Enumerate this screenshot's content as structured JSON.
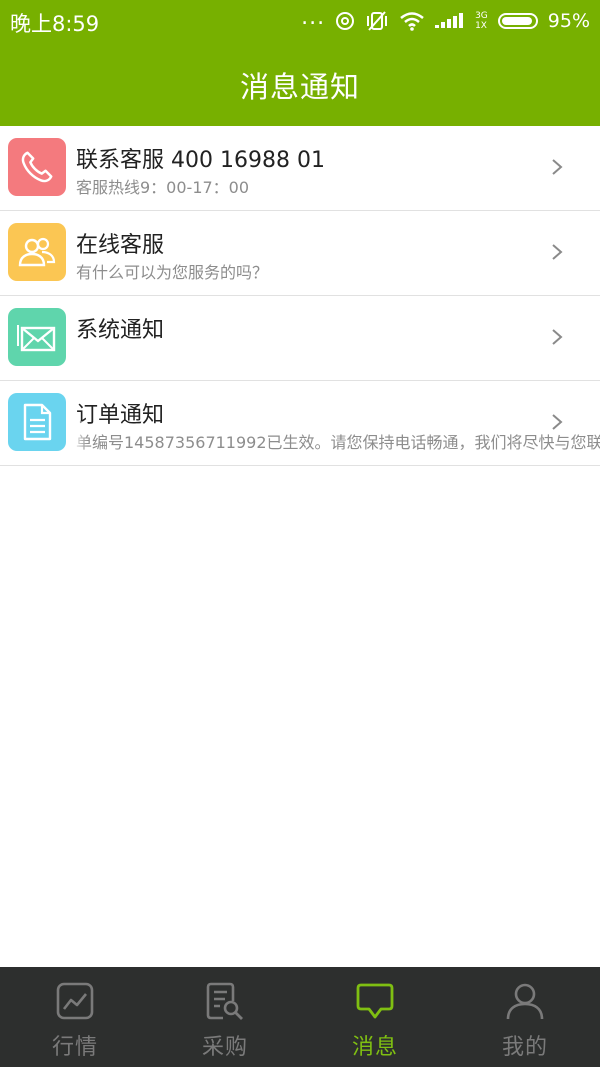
{
  "status_bar": {
    "time": "晚上8:59",
    "dots": "...",
    "network_top": "3G",
    "network_bottom": "1X",
    "battery": "95%"
  },
  "header": {
    "title": "消息通知"
  },
  "items": [
    {
      "title": "联系客服 400 16988 01",
      "subtitle": "客服热线9：00-17：00",
      "icon": "phone-icon",
      "icon_color": "#f47a7e"
    },
    {
      "title": "在线客服",
      "subtitle": "有什么可以为您服务的吗？",
      "icon": "people-icon",
      "icon_color": "#fbc653"
    },
    {
      "title": "系统通知",
      "subtitle": "",
      "icon": "envelope-icon",
      "icon_color": "#5fd5ac"
    },
    {
      "title": "订单通知",
      "subtitle": "单编号14587356711992已生效。请您保持电话畅通，我们将尽快与您联",
      "icon": "document-icon",
      "icon_color": "#6ad4ef"
    }
  ],
  "bottom_nav": {
    "tabs": [
      {
        "label": "行情",
        "icon": "chart-icon",
        "active": false
      },
      {
        "label": "采购",
        "icon": "purchase-search-icon",
        "active": false
      },
      {
        "label": "消息",
        "icon": "message-bubble-icon",
        "active": true
      },
      {
        "label": "我的",
        "icon": "user-icon",
        "active": false
      }
    ]
  },
  "colors": {
    "brand_green": "#77b000",
    "active_tab": "#7fbf12",
    "bottom_bar": "#2d2f2e"
  }
}
